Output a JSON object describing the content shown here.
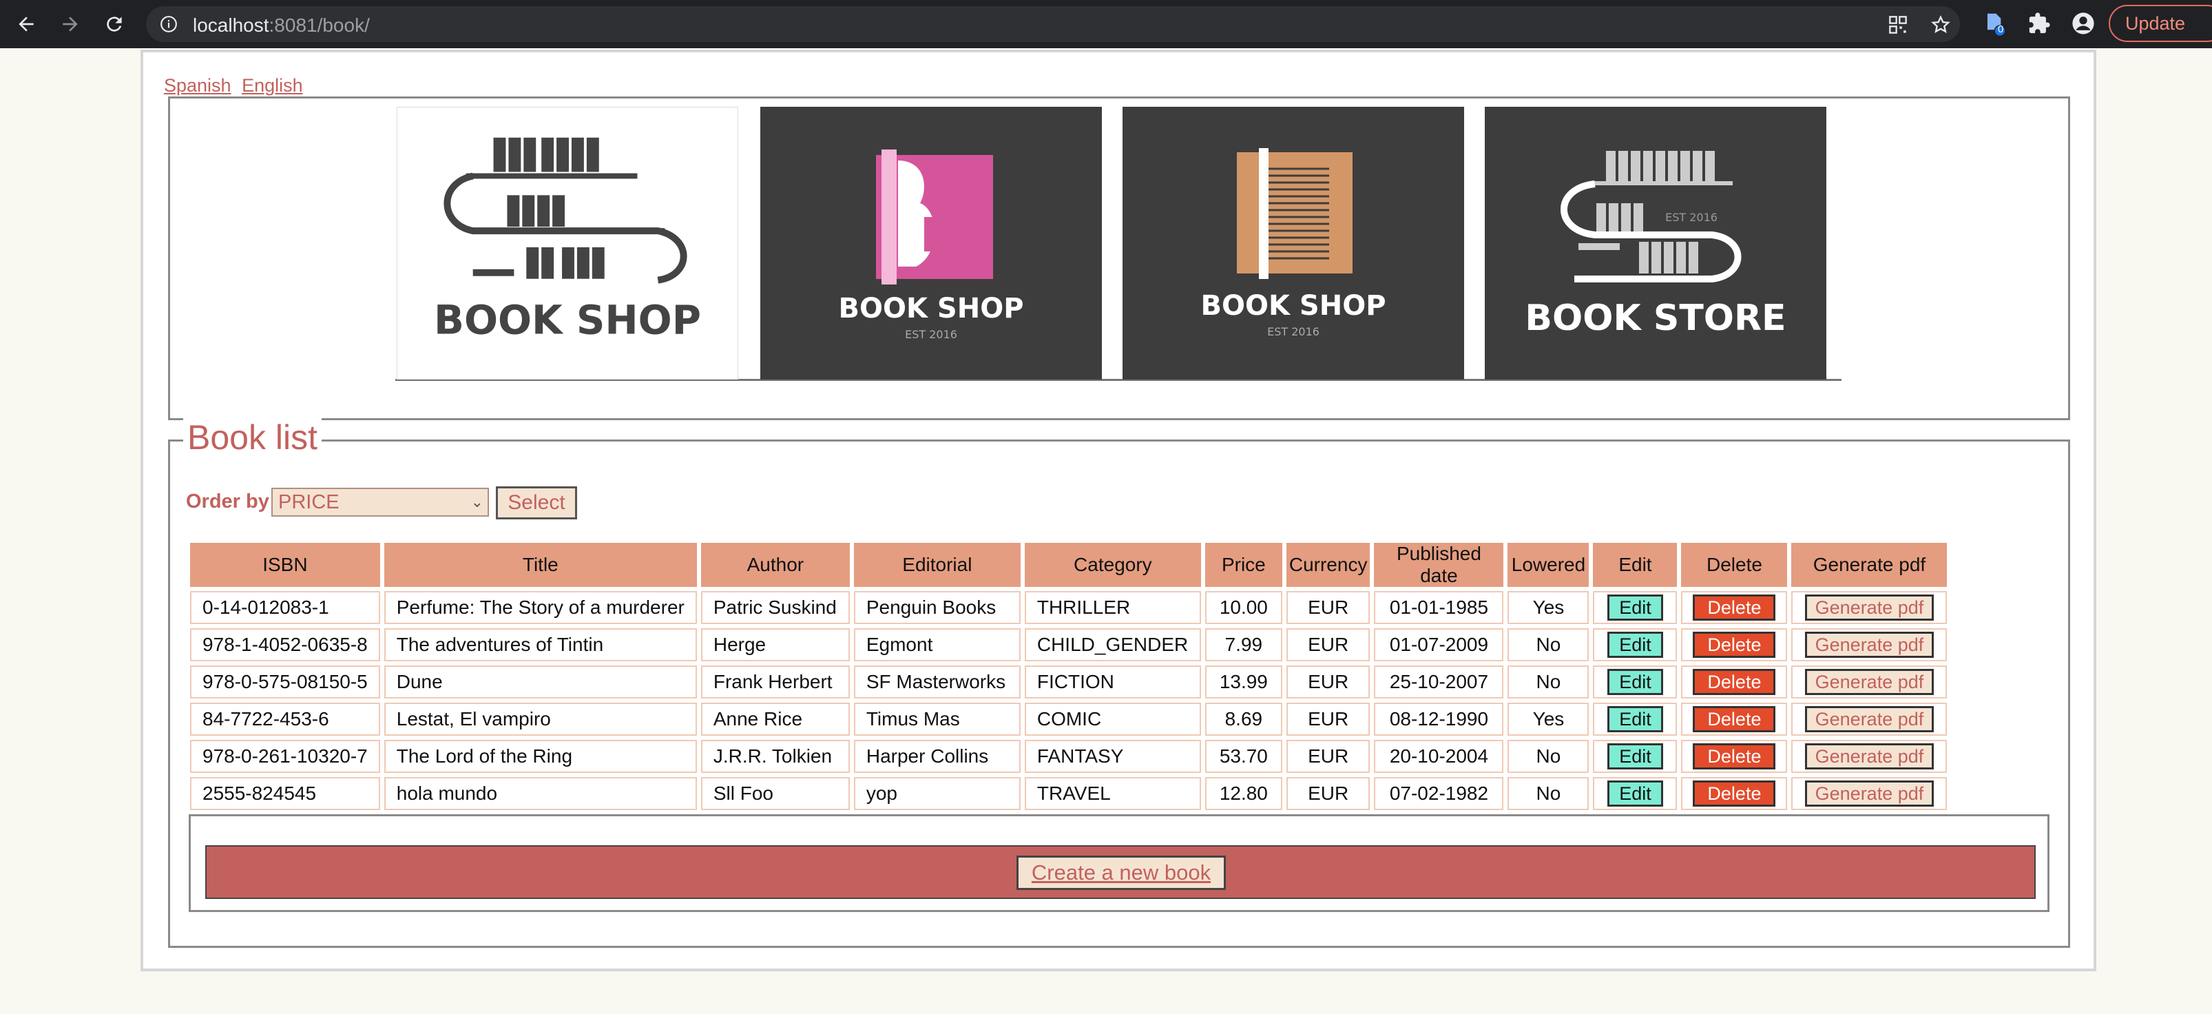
{
  "browser": {
    "url_host": "localhost",
    "url_rest": ":8081/book/",
    "update_label": "Update",
    "extension_badge": "0"
  },
  "language_links": [
    "Spanish",
    "English"
  ],
  "logos": [
    {
      "text": "BOOK SHOP",
      "sub": "",
      "style": "light"
    },
    {
      "text": "BOOK SHOP",
      "sub": "EST 2016",
      "style": "dark-pink"
    },
    {
      "text": "BOOK SHOP",
      "sub": "EST 2016",
      "style": "dark-orange"
    },
    {
      "text": "BOOK STORE",
      "sub": "EST 2016",
      "style": "dark-shelf"
    }
  ],
  "book_list": {
    "legend": "Book list",
    "order_by_label": "Order by",
    "order_by_value": "PRICE",
    "select_label": "Select",
    "columns": [
      "ISBN",
      "Title",
      "Author",
      "Editorial",
      "Category",
      "Price",
      "Currency",
      "Published date",
      "Lowered",
      "Edit",
      "Delete",
      "Generate pdf"
    ],
    "rows": [
      {
        "isbn": "0-14-012083-1",
        "title": "Perfume: The Story of a murderer",
        "author": "Patric Suskind",
        "editorial": "Penguin Books",
        "category": "THRILLER",
        "price": "10.00",
        "currency": "EUR",
        "published": "01-01-1985",
        "lowered": "Yes"
      },
      {
        "isbn": "978-1-4052-0635-8",
        "title": "The adventures of Tintin",
        "author": "Herge",
        "editorial": "Egmont",
        "category": "CHILD_GENDER",
        "price": "7.99",
        "currency": "EUR",
        "published": "01-07-2009",
        "lowered": "No"
      },
      {
        "isbn": "978-0-575-08150-5",
        "title": "Dune",
        "author": "Frank Herbert",
        "editorial": "SF Masterworks",
        "category": "FICTION",
        "price": "13.99",
        "currency": "EUR",
        "published": "25-10-2007",
        "lowered": "No"
      },
      {
        "isbn": "84-7722-453-6",
        "title": "Lestat, El vampiro",
        "author": "Anne Rice",
        "editorial": "Timus Mas",
        "category": "COMIC",
        "price": "8.69",
        "currency": "EUR",
        "published": "08-12-1990",
        "lowered": "Yes"
      },
      {
        "isbn": "978-0-261-10320-7",
        "title": "The Lord of the Ring",
        "author": "J.R.R. Tolkien",
        "editorial": "Harper Collins",
        "category": "FANTASY",
        "price": "53.70",
        "currency": "EUR",
        "published": "20-10-2004",
        "lowered": "No"
      },
      {
        "isbn": "2555-824545",
        "title": "hola mundo",
        "author": "Sll Foo",
        "editorial": "yop",
        "category": "TRAVEL",
        "price": "12.80",
        "currency": "EUR",
        "published": "07-02-1982",
        "lowered": "No"
      }
    ],
    "edit_label": "Edit",
    "delete_label": "Delete",
    "pdf_label": "Generate pdf",
    "create_label": "Create a new book"
  },
  "colors": {
    "accent": "#c2615d",
    "header": "#e49d80",
    "edit": "#7eecd3",
    "delete": "#e34b2b",
    "button_bg": "#f5e3d2"
  }
}
